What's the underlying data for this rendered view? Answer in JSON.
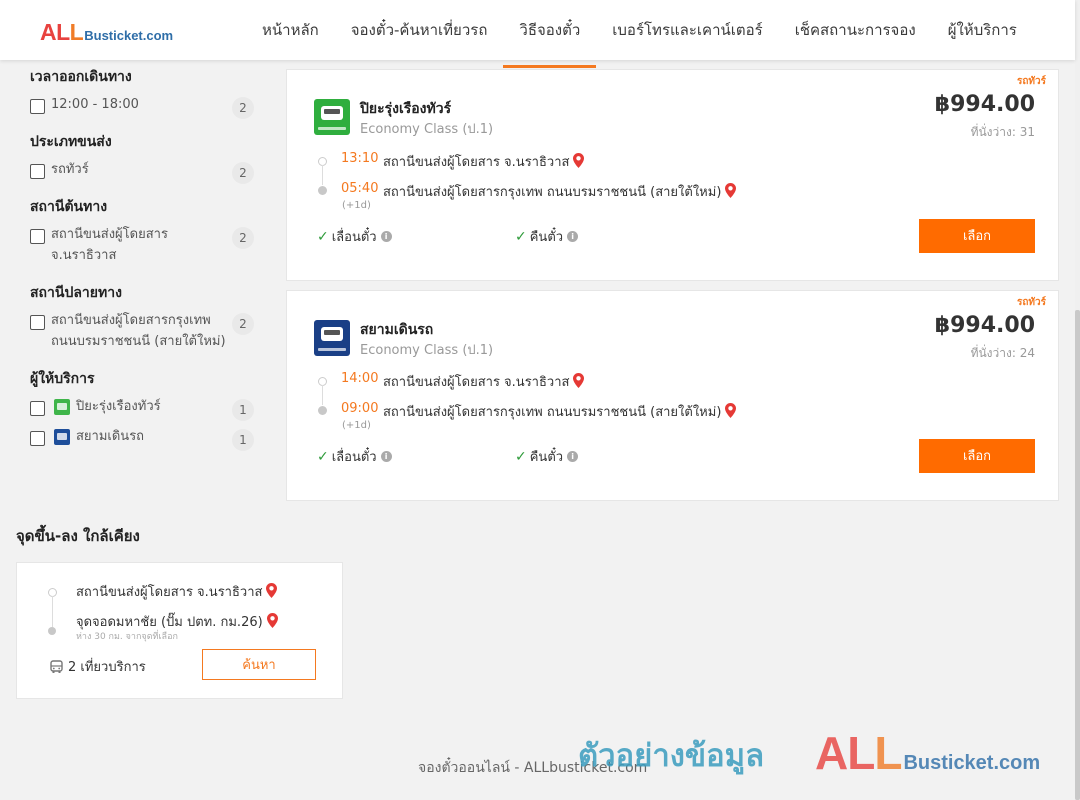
{
  "header": {
    "logo": {
      "all_a": "AL",
      "all_b": "L",
      "rest": "Busticket.com"
    },
    "nav": [
      {
        "label": "หน้าหลัก"
      },
      {
        "label": "จองตั๋ว-ค้นหาเที่ยวรถ"
      },
      {
        "label": "วิธีจองตั๋ว"
      },
      {
        "label": "เบอร์โทรและเคาน์เตอร์"
      },
      {
        "label": "เช็คสถานะการจอง"
      },
      {
        "label": "ผู้ให้บริการ"
      }
    ]
  },
  "filters": {
    "departure_time": {
      "title": "เวลาออกเดินทาง",
      "options": [
        {
          "label": "12:00 - 18:00",
          "count": "2"
        }
      ]
    },
    "transport_type": {
      "title": "ประเภทขนส่ง",
      "options": [
        {
          "label": "รถทัวร์",
          "count": "2"
        }
      ]
    },
    "origin": {
      "title": "สถานีต้นทาง",
      "options": [
        {
          "label": "สถานีขนส่งผู้โดยสาร จ.นราธิวาส",
          "count": "2"
        }
      ]
    },
    "destination": {
      "title": "สถานีปลายทาง",
      "options": [
        {
          "label": "สถานีขนส่งผู้โดยสารกรุงเทพ ถนนบรมราชชนนี (สายใต้ใหม่)",
          "count": "2"
        }
      ]
    },
    "operator": {
      "title": "ผู้ให้บริการ",
      "options": [
        {
          "label": "ปิยะรุ่งเรืองทัวร์",
          "count": "1"
        },
        {
          "label": "สยามเดินรถ",
          "count": "1"
        }
      ]
    }
  },
  "results": [
    {
      "type_tag": "รถทัวร์",
      "operator": "ปิยะรุ่งเรืองทัวร์",
      "class": "Economy Class (ป.1)",
      "price": "฿994.00",
      "seats": "ที่นั่งว่าง: 31",
      "depart_time": "13:10",
      "depart_station": "สถานีขนส่งผู้โดยสาร จ.นราธิวาส",
      "arrive_time": "05:40",
      "arrive_station": "สถานีขนส่งผู้โดยสารกรุงเทพ ถนนบรมราชชนนี (สายใต้ใหม่)",
      "plus_day": "(+1d)",
      "feature_1": "เลื่อนตั๋ว",
      "feature_2": "คืนตั๋ว",
      "button": "เลือก"
    },
    {
      "type_tag": "รถทัวร์",
      "operator": "สยามเดินรถ",
      "class": "Economy Class (ป.1)",
      "price": "฿994.00",
      "seats": "ที่นั่งว่าง: 24",
      "depart_time": "14:00",
      "depart_station": "สถานีขนส่งผู้โดยสาร จ.นราธิวาส",
      "arrive_time": "09:00",
      "arrive_station": "สถานีขนส่งผู้โดยสารกรุงเทพ ถนนบรมราชชนนี (สายใต้ใหม่)",
      "plus_day": "(+1d)",
      "feature_1": "เลื่อนตั๋ว",
      "feature_2": "คืนตั๋ว",
      "button": "เลือก"
    }
  ],
  "nearby": {
    "title": "จุดขึ้น-ลง ใกล้เคียง",
    "stop_1": "สถานีขนส่งผู้โดยสาร จ.นราธิวาส",
    "stop_2": "จุดจอดมหาชัย (ปั๊ม ปตท. กม.26)",
    "stop_2_sub": "ห่าง 30 กม. จากจุดที่เลือก",
    "trips": "2 เที่ยวบริการ",
    "search_button": "ค้นหา"
  },
  "footer": {
    "text": "จองตั๋วออนไลน์ - ALLbusticket.com",
    "watermark_th": "ตัวอย่างข้อมูล",
    "watermark_all_a": "AL",
    "watermark_all_b": "L",
    "watermark_rest": "Busticket.com"
  },
  "colors": {
    "accent": "#ff6b00",
    "brand_red": "#e8423f",
    "brand_blue": "#2f6ea8",
    "check_green": "#2e9b3a"
  }
}
